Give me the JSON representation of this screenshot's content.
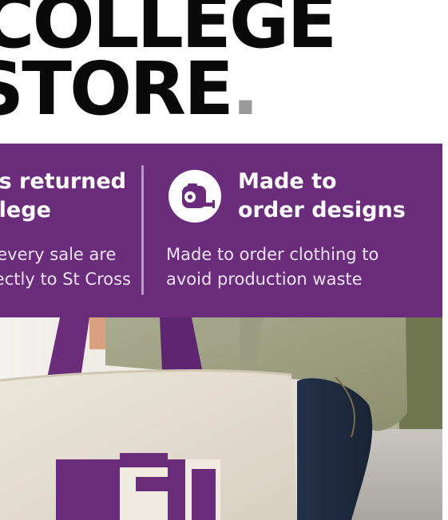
{
  "headline": {
    "line1": "COLLEGE",
    "line2": "STORE",
    "dot": "."
  },
  "features": {
    "left": {
      "heading_line1": "Profits returned",
      "heading_line2": "to college",
      "body_line1": "Profits from every sale are",
      "body_line2": "returned directly to St Cross"
    },
    "right": {
      "icon": "tape-measure-icon",
      "heading_line1": "Made to",
      "heading_line2": "order designs",
      "body_line1": "Made to order clothing to",
      "body_line2": "avoid production waste"
    }
  },
  "colors": {
    "band": "#6a2c7b",
    "headline": "#0a0a0a",
    "dot": "#9a9a9a",
    "bag_print": "#6a2c7b"
  }
}
